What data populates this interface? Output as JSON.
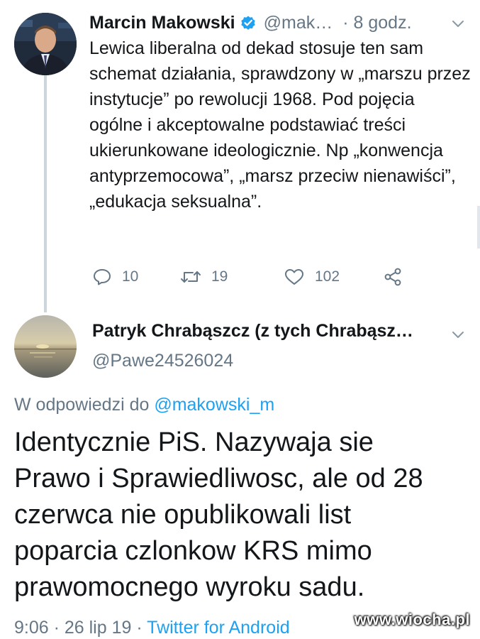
{
  "tweet1": {
    "name": "Marcin Makowski",
    "handle": "@mak…",
    "time": "· 8 godz.",
    "body": "Lewica liberalna od dekad stosuje ten sam schemat działania, sprawdzony w „marszu przez instytucje” po rewolucji 1968. Pod pojęcia ogólne i akceptowalne podstawiać treści ukierunkowane ideologicznie. Np „konwencja antyprzemocowa”, „marsz przeciw nienawiści”, „edukacja seksualna”.",
    "replies": "10",
    "retweets": "19",
    "likes": "102"
  },
  "tweet2": {
    "name": "Patryk Chrabąszcz (z tych Chrabąsz…",
    "handle": "@Pawe24526024",
    "reply_prefix": "W odpowiedzi do ",
    "reply_mention": "@makowski_m",
    "body": "Identycznie PiS. Nazywaja sie Prawo i Sprawiedliwosc, ale od 28 czerwca nie opublikowali list poparcia czlonkow KRS mimo prawomocnego wyroku sadu.",
    "timestamp": "9:06 · 26 lip 19 · ",
    "source": "Twitter for Android"
  },
  "watermark": "www.wiocha.pl",
  "colors": {
    "text": "#14171a",
    "muted": "#657786",
    "link": "#1da1f2",
    "verified": "#1da1f2",
    "thread_line": "#ccd6dd"
  },
  "icons": {
    "verified": "verified-badge-icon",
    "caret": "chevron-down-icon",
    "reply": "reply-icon",
    "retweet": "retweet-icon",
    "like": "heart-icon",
    "share": "share-icon"
  }
}
